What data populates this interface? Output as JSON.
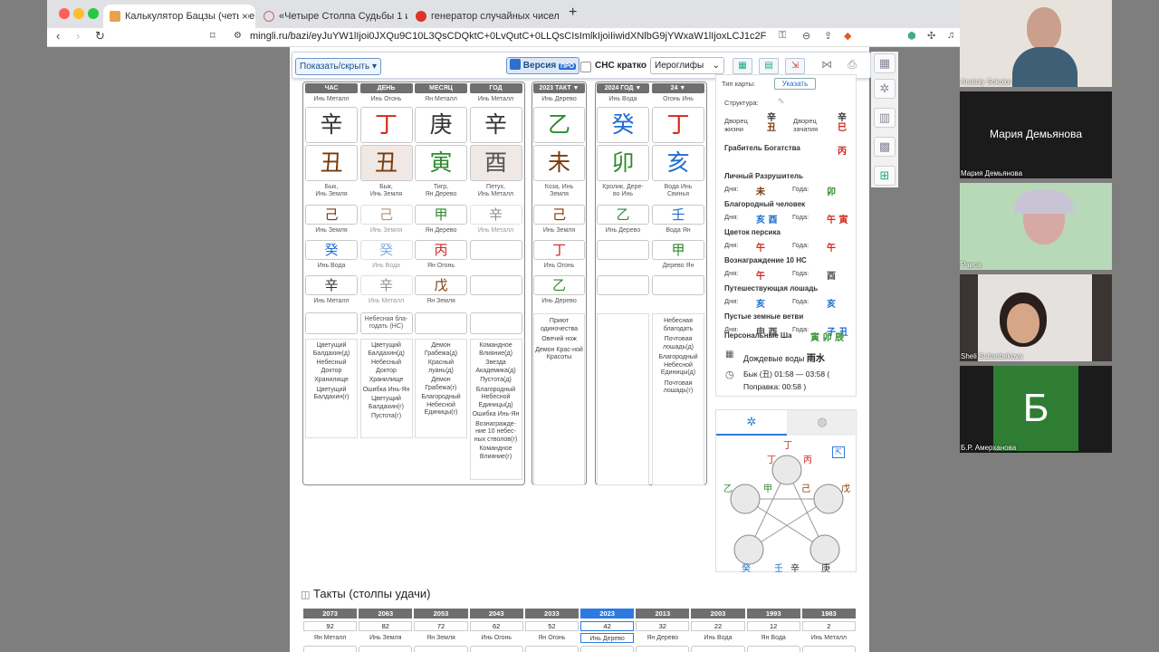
{
  "tabs": [
    {
      "title": "Калькулятор Бацзы (четыре с",
      "close": "×"
    },
    {
      "title": "«Четыре Столпа Судьбы 1 и 2» и"
    },
    {
      "title": "генератор случайных чисел — Янд"
    }
  ],
  "new_tab": "+",
  "url": "mingli.ru/bazi/eyJuYW1lIjoi0JXQu9C10L3QsCDQktC+0LvQutC+0LLQsCIsImlkIjoiIiwidXNlbG9jYWxaW1lIjoxLCJ1c2FibGVnb",
  "toolbar": {
    "show_hide": "Показать/скрыть",
    "version_label": "Версия",
    "pro_badge": "ПРО",
    "chs_label": "СНС кратко",
    "hieroglyphs_select": "Иероглифы"
  },
  "columns": [
    {
      "head": "ЧАС",
      "top_label": "Инь Металл",
      "stem": "辛",
      "stem_color": "#333333",
      "branch": "丑",
      "branch_color": "#7b3a07",
      "branch_shade": false,
      "branch_label": [
        "Бык,",
        "Инь Земля"
      ],
      "hidden": [
        {
          "g": "己",
          "c": "#7b3a07",
          "l": "Инь Земля",
          "faded": false
        },
        {
          "g": "癸",
          "c": "#1f6fd1",
          "l": "Инь Вода",
          "faded": false
        },
        {
          "g": "辛",
          "c": "#333333",
          "l": "Инь Металл",
          "faded": false
        }
      ],
      "extra": "",
      "stars": [
        "Цветущий Балдахин(д)",
        "Небесный Доктор",
        "Хранилище",
        "Цветущий Балдахин(г)"
      ]
    },
    {
      "head": "ДЕНЬ",
      "top_label": "Инь Огонь",
      "stem": "丁",
      "stem_color": "#d4271b",
      "branch": "丑",
      "branch_color": "#7b3a07",
      "branch_shade": true,
      "branch_label": [
        "Бык,",
        "Инь Земля"
      ],
      "hidden": [
        {
          "g": "己",
          "c": "#7b3a07",
          "l": "Инь Земля",
          "faded": true
        },
        {
          "g": "癸",
          "c": "#1f6fd1",
          "l": "Инь Вода",
          "faded": true
        },
        {
          "g": "辛",
          "c": "#333333",
          "l": "Инь Металл",
          "faded": true
        }
      ],
      "extra": "Небесная бла-годать (НС)",
      "stars": [
        "Цветущий Балдахин(д)",
        "Небесный Доктор",
        "Хранилище",
        "Ошибка Инь-Ян",
        "Цветущий Балдахин(г)",
        "Пустота(г)"
      ]
    },
    {
      "head": "МЕСЯЦ",
      "top_label": "Ян Металл",
      "stem": "庚",
      "stem_color": "#333333",
      "branch": "寅",
      "branch_color": "#2f8a2f",
      "branch_shade": false,
      "branch_label": [
        "Тигр,",
        "Ян Дерево"
      ],
      "hidden": [
        {
          "g": "甲",
          "c": "#2f8a2f",
          "l": "Ян Дерево",
          "faded": false
        },
        {
          "g": "丙",
          "c": "#d4271b",
          "l": "Ян Огонь",
          "faded": false
        },
        {
          "g": "戊",
          "c": "#7b3a07",
          "l": "Ян Земля",
          "faded": false
        }
      ],
      "extra": "",
      "stars": [
        "Демон Грабежа(д)",
        "Красный луань(д)",
        "Демон Грабежа(г)",
        "Благородный Небесной Единицы(г)"
      ]
    },
    {
      "head": "ГОД",
      "top_label": "Инь Металл",
      "stem": "辛",
      "stem_color": "#333333",
      "branch": "酉",
      "branch_color": "#555555",
      "branch_shade": true,
      "branch_label": [
        "Петух,",
        "Инь Металл"
      ],
      "hidden": [
        {
          "g": "辛",
          "c": "#333333",
          "l": "Инь Металл",
          "faded": true
        },
        {
          "g": "",
          "c": "#333",
          "l": "",
          "faded": false
        },
        {
          "g": "",
          "c": "#333",
          "l": "",
          "faded": false
        }
      ],
      "extra": "",
      "stars": [
        "Командное Влияние(д)",
        "Звезда Академика(д)",
        "Пустота(д)",
        "Благородный Небесной Единицы(д)",
        "Ошибка Инь-Ян",
        "Вознагражде-ние 10 небес-ных стволов(г)",
        "Командное Влияние(г)"
      ]
    }
  ],
  "takt": {
    "head": "2023 ТАКТ ▼",
    "top_label": "Инь Дерево",
    "stem": "乙",
    "stem_color": "#2f8a2f",
    "branch": "未",
    "branch_color": "#7b3a07",
    "branch_label": [
      "Коза, Инь",
      "Земля"
    ],
    "hidden": [
      {
        "g": "己",
        "c": "#7b3a07",
        "l": "Инь Земля"
      },
      {
        "g": "丁",
        "c": "#d4271b",
        "l": "Инь Огонь"
      },
      {
        "g": "乙",
        "c": "#2f8a2f",
        "l": "Инь Дерево"
      }
    ],
    "stars": [
      "Приют одиночества",
      "Овечий нож",
      "Демон Крас-ной Красоты"
    ]
  },
  "year": {
    "head": "2024 ГОД ▼",
    "top_label": "Инь Вода",
    "stem": "癸",
    "stem_color": "#1f6fd1",
    "branch": "卯",
    "branch_color": "#2f8a2f",
    "branch_label": [
      "Кролик, Дере-",
      "во Инь"
    ],
    "hidden": [
      {
        "g": "乙",
        "c": "#2f8a2f",
        "l": "Инь Дерево"
      },
      {
        "g": "",
        "c": "#333",
        "l": ""
      },
      {
        "g": "",
        "c": "#333",
        "l": ""
      }
    ]
  },
  "day24": {
    "head": "24 ▼",
    "top_label": "Огонь Инь",
    "stem": "丁",
    "stem_color": "#d4271b",
    "branch": "亥",
    "branch_color": "#1f6fd1",
    "branch_label": [
      "Вода Инь",
      "Свинья"
    ],
    "hidden": [
      {
        "g": "壬",
        "c": "#1f6fd1",
        "l": "Вода Ян"
      },
      {
        "g": "甲",
        "c": "#2f8a2f",
        "l": "Дерево Ян"
      },
      {
        "g": "",
        "c": "#333",
        "l": ""
      }
    ],
    "stars": [
      "Небесная благодать",
      "Почтовая лошадь(д)",
      "Благородный Небесной Единицы(д)",
      "Почтовая лошадь(г)"
    ]
  },
  "right": {
    "map_type": "Тип карты:",
    "indicate": "Указать",
    "structure": "Структура:",
    "palace_life": "Дворец жизни",
    "palace_life_g": [
      "辛",
      "丑"
    ],
    "palace_concept": "Дворец зачатия",
    "palace_concept_g": [
      "辛",
      "巳"
    ],
    "stars": [
      {
        "name": "Грабитель Богатства",
        "right": "丙",
        "rc": "#d4271b"
      },
      {
        "name": "Личный Разрушитель",
        "day": "未",
        "dc": "#7b3a07",
        "year": "卯",
        "yc": "#2f8a2f"
      },
      {
        "name": "Благородный человек",
        "day": "亥 酉",
        "dc": "#1f6fd1",
        "year": "午 寅",
        "yc": "#d4271b"
      },
      {
        "name": "Цветок персика",
        "day": "午",
        "dc": "#d4271b",
        "year": "午",
        "yc": "#d4271b"
      },
      {
        "name": "Вознаграждение 10 НС",
        "day": "午",
        "dc": "#d4271b",
        "year": "酉",
        "yc": "#555555"
      },
      {
        "name": "Путешествующая лошадь",
        "day": "亥",
        "dc": "#1f6fd1",
        "year": "亥",
        "yc": "#1f6fd1"
      },
      {
        "name": "Пустые земные ветви",
        "day": "申 酉",
        "dc": "#555555",
        "year": "子 丑",
        "yc": "#1f6fd1"
      }
    ],
    "day_lbl": "Дня:",
    "year_lbl": "Года:",
    "personal": "Персональные Ша",
    "personal_g": "寅 卯 辰",
    "rain": "Дождевые воды",
    "rain_g": "雨水",
    "hour": "Бык (丑) 01:58 — 03:58  (",
    "fix": "Поправка: 00:58 )"
  },
  "wheel": {
    "top": "丁",
    "top2": "丙",
    "left": "乙",
    "left2": "甲",
    "right": "己",
    "right2": "戊",
    "bl": "癸",
    "bl2": "壬",
    "br": "辛",
    "br2": "庚",
    "t2": "丁"
  },
  "luck": {
    "title": "Такты (столпы удачи)",
    "years": [
      "2073",
      "2063",
      "2053",
      "2043",
      "2033",
      "2023",
      "2013",
      "2003",
      "1993",
      "1983"
    ],
    "ages": [
      "92",
      "82",
      "72",
      "62",
      "52",
      "42",
      "32",
      "22",
      "12",
      "2"
    ],
    "elements": [
      "Ян Металл",
      "Инь Земля",
      "Ян Земля",
      "Инь Огонь",
      "Ян Огонь",
      "Инь Дерево",
      "Ян Дерево",
      "Инь Вода",
      "Ян Вода",
      "Инь Металл"
    ],
    "selected": 5
  },
  "video": [
    {
      "name": "Anatoly Sokolov"
    },
    {
      "name": "Мария Демьянова",
      "center": "Мария Демьянова"
    },
    {
      "name": "Раиса"
    },
    {
      "name": "Sheli Sultanbekova"
    },
    {
      "name": "Б.Р. Амерханова",
      "avatar": "Б"
    }
  ]
}
